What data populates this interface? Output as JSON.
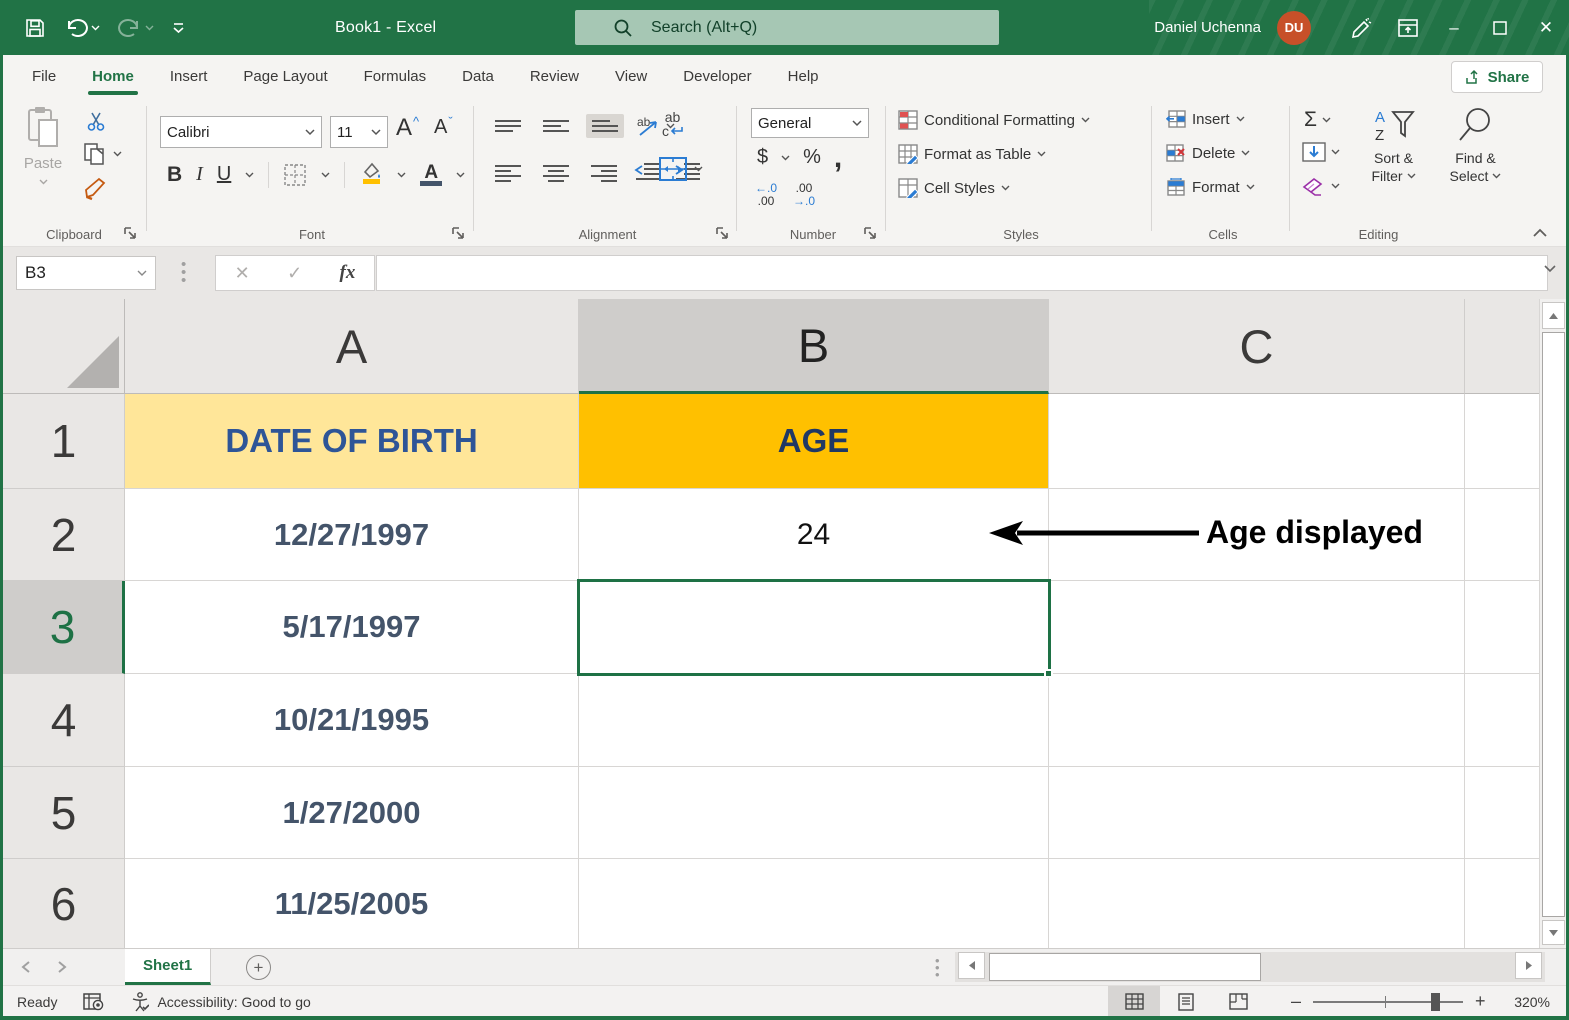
{
  "window": {
    "title": "Book1  -  Excel",
    "user_name": "Daniel Uchenna",
    "user_initials": "DU",
    "minimize": "–",
    "maximize": "",
    "close": "✕"
  },
  "search": {
    "placeholder": "Search (Alt+Q)"
  },
  "tabs": {
    "file": "File",
    "home": "Home",
    "insert": "Insert",
    "page_layout": "Page Layout",
    "formulas": "Formulas",
    "data": "Data",
    "review": "Review",
    "view": "View",
    "developer": "Developer",
    "help": "Help",
    "share": "Share"
  },
  "ribbon": {
    "clipboard": {
      "label": "Clipboard",
      "paste": "Paste"
    },
    "font": {
      "label": "Font",
      "font_name": "Calibri",
      "font_size": "11",
      "bold": "B",
      "italic": "I",
      "underline": "U",
      "grow": "A",
      "shrink": "A"
    },
    "alignment": {
      "label": "Alignment",
      "wrap_top": "ab",
      "wrap_bottom": "c"
    },
    "number": {
      "label": "Number",
      "format": "General",
      "currency": "$",
      "percent": "%",
      "comma": ",",
      "inc_dec_top": "←.0",
      "inc_dec_bottom": ".00",
      "dec_dec_top": ".00",
      "dec_dec_bottom": "→.0"
    },
    "styles": {
      "label": "Styles",
      "conditional": "Conditional Formatting",
      "format_table": "Format as Table",
      "cell_styles": "Cell Styles"
    },
    "cells": {
      "label": "Cells",
      "insert": "Insert",
      "delete": "Delete",
      "format": "Format"
    },
    "editing": {
      "label": "Editing",
      "autosum": "Σ",
      "sort_line1": "Sort &",
      "sort_line2": "Filter",
      "find_line1": "Find &",
      "find_line2": "Select",
      "az_a": "A",
      "az_z": "Z"
    }
  },
  "formula_bar": {
    "name_box": "B3",
    "cancel": "✕",
    "enter": "✓",
    "fx": "fx",
    "formula": ""
  },
  "grid": {
    "columns": {
      "a": "A",
      "b": "B",
      "c": "C"
    },
    "header_row": {
      "number": "1",
      "dob": "DATE OF BIRTH",
      "age": "AGE"
    },
    "rows": [
      {
        "number": "2",
        "date": "12/27/1997",
        "age": "24"
      },
      {
        "number": "3",
        "date": "5/17/1997",
        "age": ""
      },
      {
        "number": "4",
        "date": "10/21/1995",
        "age": ""
      },
      {
        "number": "5",
        "date": "1/27/2000",
        "age": ""
      },
      {
        "number": "6",
        "date": "11/25/2005",
        "age": ""
      }
    ],
    "selected_cell": "B3",
    "annotation": "Age displayed"
  },
  "sheet_bar": {
    "tab1": "Sheet1",
    "add": "+"
  },
  "status_bar": {
    "ready": "Ready",
    "accessibility": "Accessibility: Good to go",
    "zoom_level": "320%",
    "zoom_minus": "–",
    "zoom_plus": "+"
  },
  "colors": {
    "brand_green": "#217346",
    "selection_green": "#1E7145",
    "header_yellow": "#FFE699",
    "header_gold": "#FFC000",
    "date_text": "#44546A",
    "dob_text": "#2E5597",
    "age_header_text": "#203864",
    "avatar_orange": "#C75029",
    "search_pill": "#A6C7B4"
  }
}
